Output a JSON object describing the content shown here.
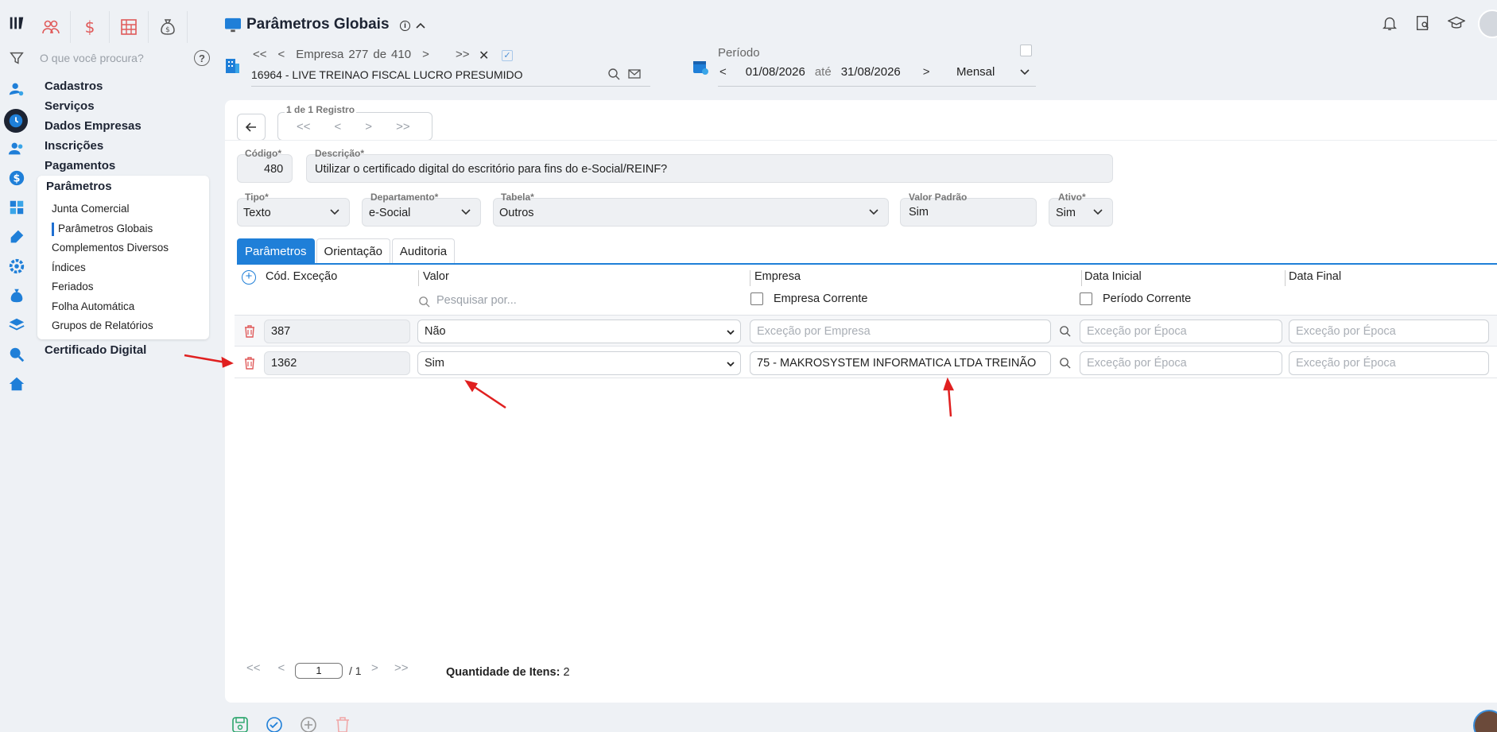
{
  "header": {
    "title": "Parâmetros Globais",
    "empresa_label": "Empresa",
    "empresa_current": "277",
    "empresa_of": "de",
    "empresa_total": "410",
    "empresa_name": "16964 - LIVE TREINAO FISCAL LUCRO PRESUMIDO",
    "periodo_label": "Período",
    "periodo_start": "01/08/2026",
    "periodo_ate": "até",
    "periodo_end": "31/08/2026",
    "periodo_freq": "Mensal"
  },
  "sidebar": {
    "search_placeholder": "O que você procura?",
    "items": [
      "Cadastros",
      "Serviços",
      "Dados Empresas",
      "Inscrições",
      "Pagamentos"
    ],
    "submenu_title": "Parâmetros",
    "submenu": [
      "Junta Comercial",
      "Parâmetros Globais",
      "Complementos Diversos",
      "Índices",
      "Feriados",
      "Folha Automática",
      "Grupos de Relatórios"
    ],
    "after": "Certificado Digital"
  },
  "record": {
    "counter": "1 de 1 Registro",
    "codigo_label": "Código*",
    "codigo": "480",
    "descricao_label": "Descrição*",
    "descricao": "Utilizar o certificado digital do escritório para fins do e-Social/REINF?",
    "tipo_label": "Tipo*",
    "tipo": "Texto",
    "departamento_label": "Departamento*",
    "departamento": "e-Social",
    "tabela_label": "Tabela*",
    "tabela": "Outros",
    "valor_padrao_label": "Valor Padrão",
    "valor_padrao": "Sim",
    "ativo_label": "Ativo*",
    "ativo": "Sim"
  },
  "tabs": [
    "Parâmetros",
    "Orientação",
    "Auditoria"
  ],
  "grid": {
    "headers": [
      "Cód. Exceção",
      "Valor",
      "Empresa",
      "Data Inicial",
      "Data Final"
    ],
    "search_placeholder": "Pesquisar por...",
    "empresa_corrente": "Empresa Corrente",
    "periodo_corrente": "Período Corrente",
    "rows": [
      {
        "codigo": "387",
        "valor": "Não",
        "empresa": "Exceção por Empresa",
        "data_inicial": "Exceção por Época",
        "data_final": "Exceção por Época"
      },
      {
        "codigo": "1362",
        "valor": "Sim",
        "empresa": "75 - MAKROSYSTEM INFORMATICA LTDA TREINÃO",
        "data_inicial": "Exceção por Época",
        "data_final": "Exceção por Época"
      }
    ]
  },
  "pager": {
    "page": "1",
    "total": "/ 1",
    "qtd_label": "Quantidade de Itens:",
    "qtd": "2"
  },
  "colors": {
    "accent": "#1f7fd8",
    "danger": "#e05a5a",
    "annotation": "#e02020"
  }
}
